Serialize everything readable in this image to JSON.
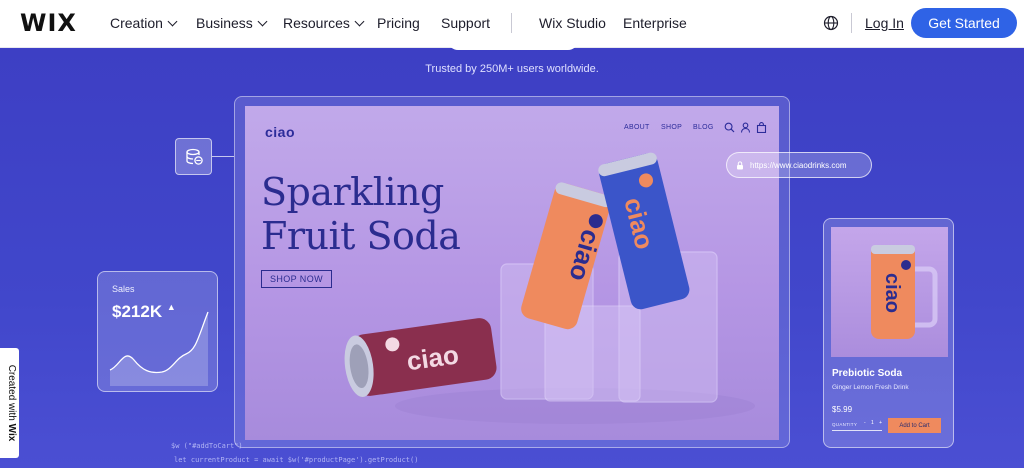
{
  "nav": {
    "logo": "WIX",
    "items": [
      {
        "label": "Creation",
        "dropdown": true
      },
      {
        "label": "Business",
        "dropdown": true
      },
      {
        "label": "Resources",
        "dropdown": true
      },
      {
        "label": "Pricing",
        "dropdown": false
      },
      {
        "label": "Support",
        "dropdown": false
      },
      {
        "label": "Wix Studio",
        "dropdown": false
      },
      {
        "label": "Enterprise",
        "dropdown": false
      }
    ],
    "login": "Log In",
    "cta": "Get Started"
  },
  "hero": {
    "trusted": "Trusted by 250M+ users worldwide."
  },
  "site_preview": {
    "logo": "ciao",
    "nav": [
      "ABOUT",
      "SHOP",
      "BLOG"
    ],
    "headline_line1": "Sparkling",
    "headline_line2": "Fruit Soda",
    "shop_button": "SHOP NOW",
    "can_brand": "ciao"
  },
  "sales_card": {
    "label": "Sales",
    "value": "$212K"
  },
  "url_bar": {
    "url": "https://www.ciaodrinks.com"
  },
  "product_card": {
    "name": "Prebiotic Soda",
    "subtitle": "Ginger Lemon Fresh Drink",
    "price": "$5.99",
    "quantity_label": "QUANTITY",
    "quantity": "1",
    "add_to_cart": "Add to Cart"
  },
  "badge": {
    "created_with": "Created with",
    "brand": "Wix"
  },
  "code": {
    "line1": "$w (\"#addToCart\")",
    "line2": "let currentProduct = await $w('#productPage').getProduct()"
  },
  "colors": {
    "background": "#3d3fc8",
    "cta": "#2f63e6",
    "site_ink": "#2b2c8f",
    "can_orange": "#ef8a5e",
    "can_blue": "#3b55c9",
    "can_maroon": "#8a2f4e"
  }
}
